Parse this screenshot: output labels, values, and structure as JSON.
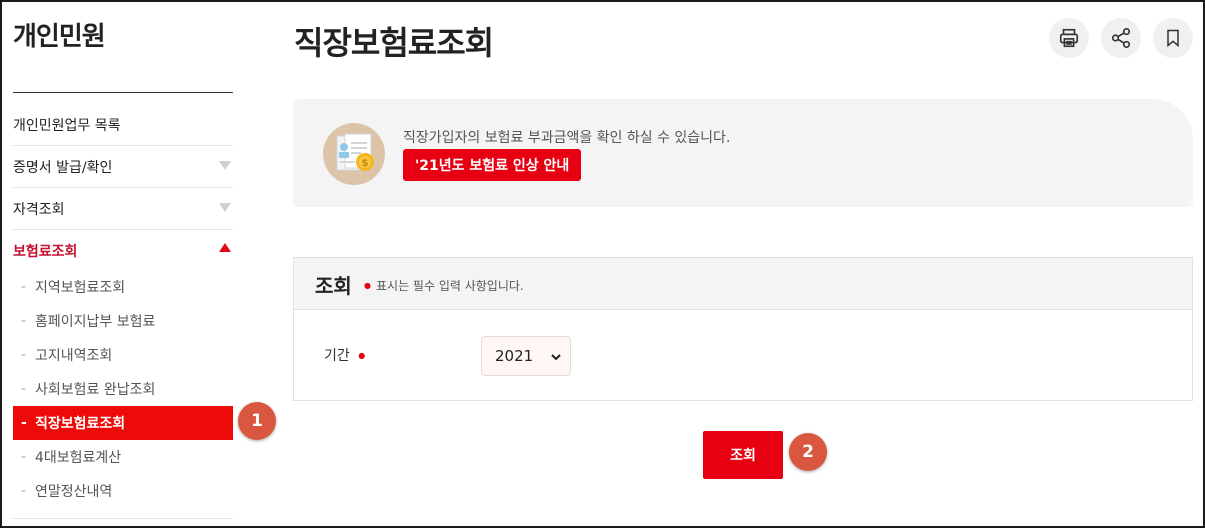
{
  "sidebar": {
    "title": "개인민원",
    "items": [
      {
        "label": "개인민원업무 목록"
      },
      {
        "label": "증명서 발급/확인"
      },
      {
        "label": "자격조회"
      },
      {
        "label": "보험료조회"
      }
    ],
    "sub_items": [
      {
        "label": "지역보험료조회"
      },
      {
        "label": "홈페이지납부 보험료"
      },
      {
        "label": "고지내역조회"
      },
      {
        "label": "사회보험료 완납조회"
      },
      {
        "label": "직장보험료조회"
      },
      {
        "label": "4대보험료계산"
      },
      {
        "label": "연말정산내역"
      }
    ],
    "sub_dash": "-"
  },
  "badges": {
    "first": "1",
    "second": "2"
  },
  "main": {
    "title": "직장보험료조회",
    "toolbar_icons": [
      "print-icon",
      "share-icon",
      "bookmark-icon"
    ],
    "info": {
      "text": "직장가입자의 보험료 부과금액을 확인 하실 수 있습니다.",
      "button_label": "'21년도 보험료 인상 안내"
    },
    "form": {
      "title": "조회",
      "required_mark": "●",
      "note": "표시는 필수 입력 사항입니다.",
      "period_label": "기간",
      "year_value": "2021"
    },
    "submit_label": "조회"
  },
  "colors": {
    "accent": "#e60012",
    "badge": "#d9573f",
    "panel": "#f4f4f4"
  }
}
